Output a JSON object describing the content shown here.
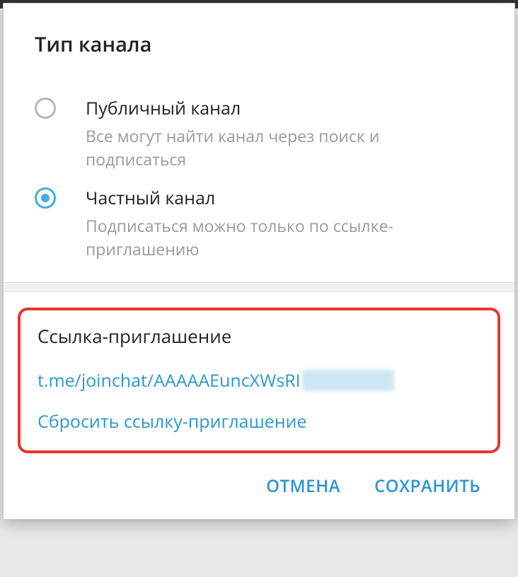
{
  "header": {
    "title": "Тип канала"
  },
  "channel_type": {
    "public": {
      "label": "Публичный канал",
      "desc": "Все могут найти канал через поиск и подписаться"
    },
    "private": {
      "label": "Частный канал",
      "desc": "Подписаться можно только по ссылке-приглашению"
    }
  },
  "invite": {
    "title": "Ссылка-приглашение",
    "link_visible": "t.me/joinchat/AAAAAEuncXWsRI",
    "reset_label": "Сбросить ссылку-приглашение"
  },
  "footer": {
    "cancel": "ОТМЕНА",
    "save": "СОХРАНИТЬ"
  }
}
